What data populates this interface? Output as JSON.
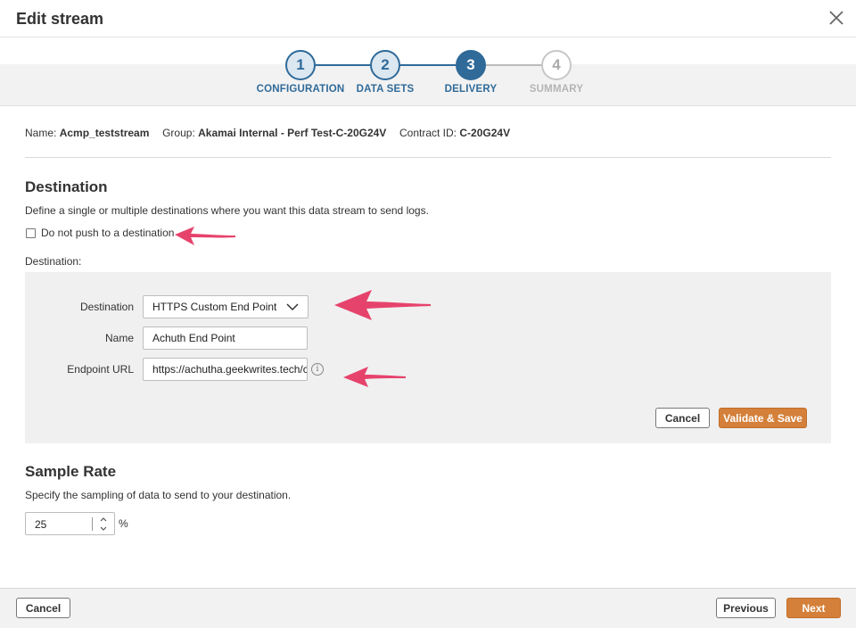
{
  "dialog": {
    "title": "Edit stream"
  },
  "stepper": {
    "steps": [
      {
        "number": "1",
        "label": "CONFIGURATION",
        "state": "done"
      },
      {
        "number": "2",
        "label": "DATA SETS",
        "state": "done"
      },
      {
        "number": "3",
        "label": "DELIVERY",
        "state": "active"
      },
      {
        "number": "4",
        "label": "SUMMARY",
        "state": "todo"
      }
    ]
  },
  "stream_info": {
    "name_label": "Name:",
    "name_value": "Acmp_teststream",
    "group_label": "Group:",
    "group_value": "Akamai Internal - Perf Test-C-20G24V",
    "contract_label": "Contract ID:",
    "contract_value": "C-20G24V"
  },
  "destination_section": {
    "title": "Destination",
    "description": "Define a single or multiple destinations where you want this data stream to send logs.",
    "checkbox_label": "Do not push to a destination",
    "checkbox_checked": false,
    "destination_label": "Destination:"
  },
  "destination_form": {
    "destination_field_label": "Destination",
    "destination_value": "HTTPS Custom End Point",
    "name_field_label": "Name",
    "name_value": "Achuth End Point",
    "endpoint_field_label": "Endpoint URL",
    "endpoint_value": "https://achutha.geekwrites.tech/c",
    "cancel_label": "Cancel",
    "validate_label": "Validate & Save"
  },
  "sample_rate": {
    "title": "Sample Rate",
    "description": "Specify the sampling of data to send to your destination.",
    "value": "25",
    "unit": "%"
  },
  "footer": {
    "cancel_label": "Cancel",
    "previous_label": "Previous",
    "next_label": "Next"
  },
  "colors": {
    "primary": "#2f6a99",
    "accent_orange": "#d4803a",
    "annotation_arrow": "#e6436c"
  }
}
